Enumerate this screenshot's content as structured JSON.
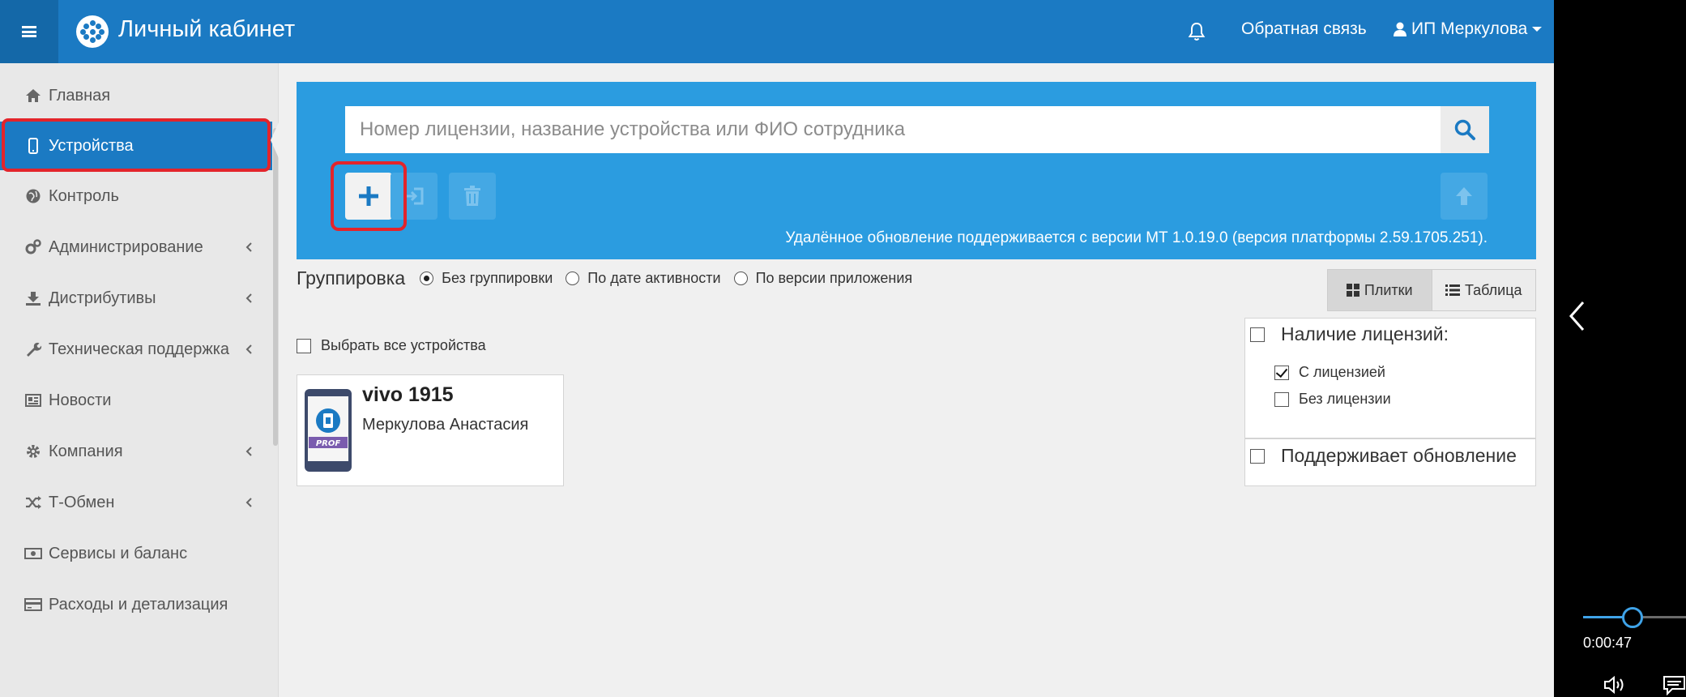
{
  "header": {
    "title": "Личный кабинет",
    "feedback": "Обратная связь",
    "user": "ИП Меркулова"
  },
  "sidebar": {
    "items": [
      {
        "label": "Главная",
        "icon": "home-icon"
      },
      {
        "label": "Устройства",
        "icon": "mobile-icon",
        "active": true
      },
      {
        "label": "Контроль",
        "icon": "globe-icon"
      },
      {
        "label": "Администрирование",
        "icon": "gears-icon",
        "chevron": true
      },
      {
        "label": "Дистрибутивы",
        "icon": "download-icon",
        "chevron": true
      },
      {
        "label": "Техническая поддержка",
        "icon": "wrench-icon",
        "chevron": true
      },
      {
        "label": "Новости",
        "icon": "newspaper-icon"
      },
      {
        "label": "Компания",
        "icon": "gear-icon",
        "chevron": true
      },
      {
        "label": "Т-Обмен",
        "icon": "shuffle-icon",
        "chevron": true
      },
      {
        "label": "Сервисы и баланс",
        "icon": "money-icon"
      },
      {
        "label": "Расходы и детализация",
        "icon": "card-icon"
      }
    ]
  },
  "search": {
    "placeholder": "Номер лицензии, название устройства или ФИО сотрудника",
    "value": ""
  },
  "update_note": "Удалённое обновление поддерживается с версии МТ 1.0.19.0 (версия платформы 2.59.1705.251).",
  "grouping": {
    "label": "Группировка",
    "options": [
      "Без группировки",
      "По дате активности",
      "По версии приложения"
    ],
    "selected": "Без группировки"
  },
  "view": {
    "tiles": "Плитки",
    "table": "Таблица",
    "selected": "Плитки"
  },
  "select_all": "Выбрать все устройства",
  "device": {
    "name": "vivo 1915",
    "user": "Меркулова Анастасия",
    "badge": "PROF"
  },
  "filters": {
    "licenses_title": "Наличие лицензий:",
    "with_license": "С лицензией",
    "without_license": "Без лицензии",
    "supports_update": "Поддерживает обновление",
    "with_license_checked": true,
    "without_license_checked": false,
    "supports_update_checked": false
  },
  "video": {
    "time": "0:00:47",
    "progress": 0.48
  },
  "colors": {
    "brand": "#1b7ac3",
    "panel": "#2b9ce0",
    "highlight": "#e3242b"
  }
}
